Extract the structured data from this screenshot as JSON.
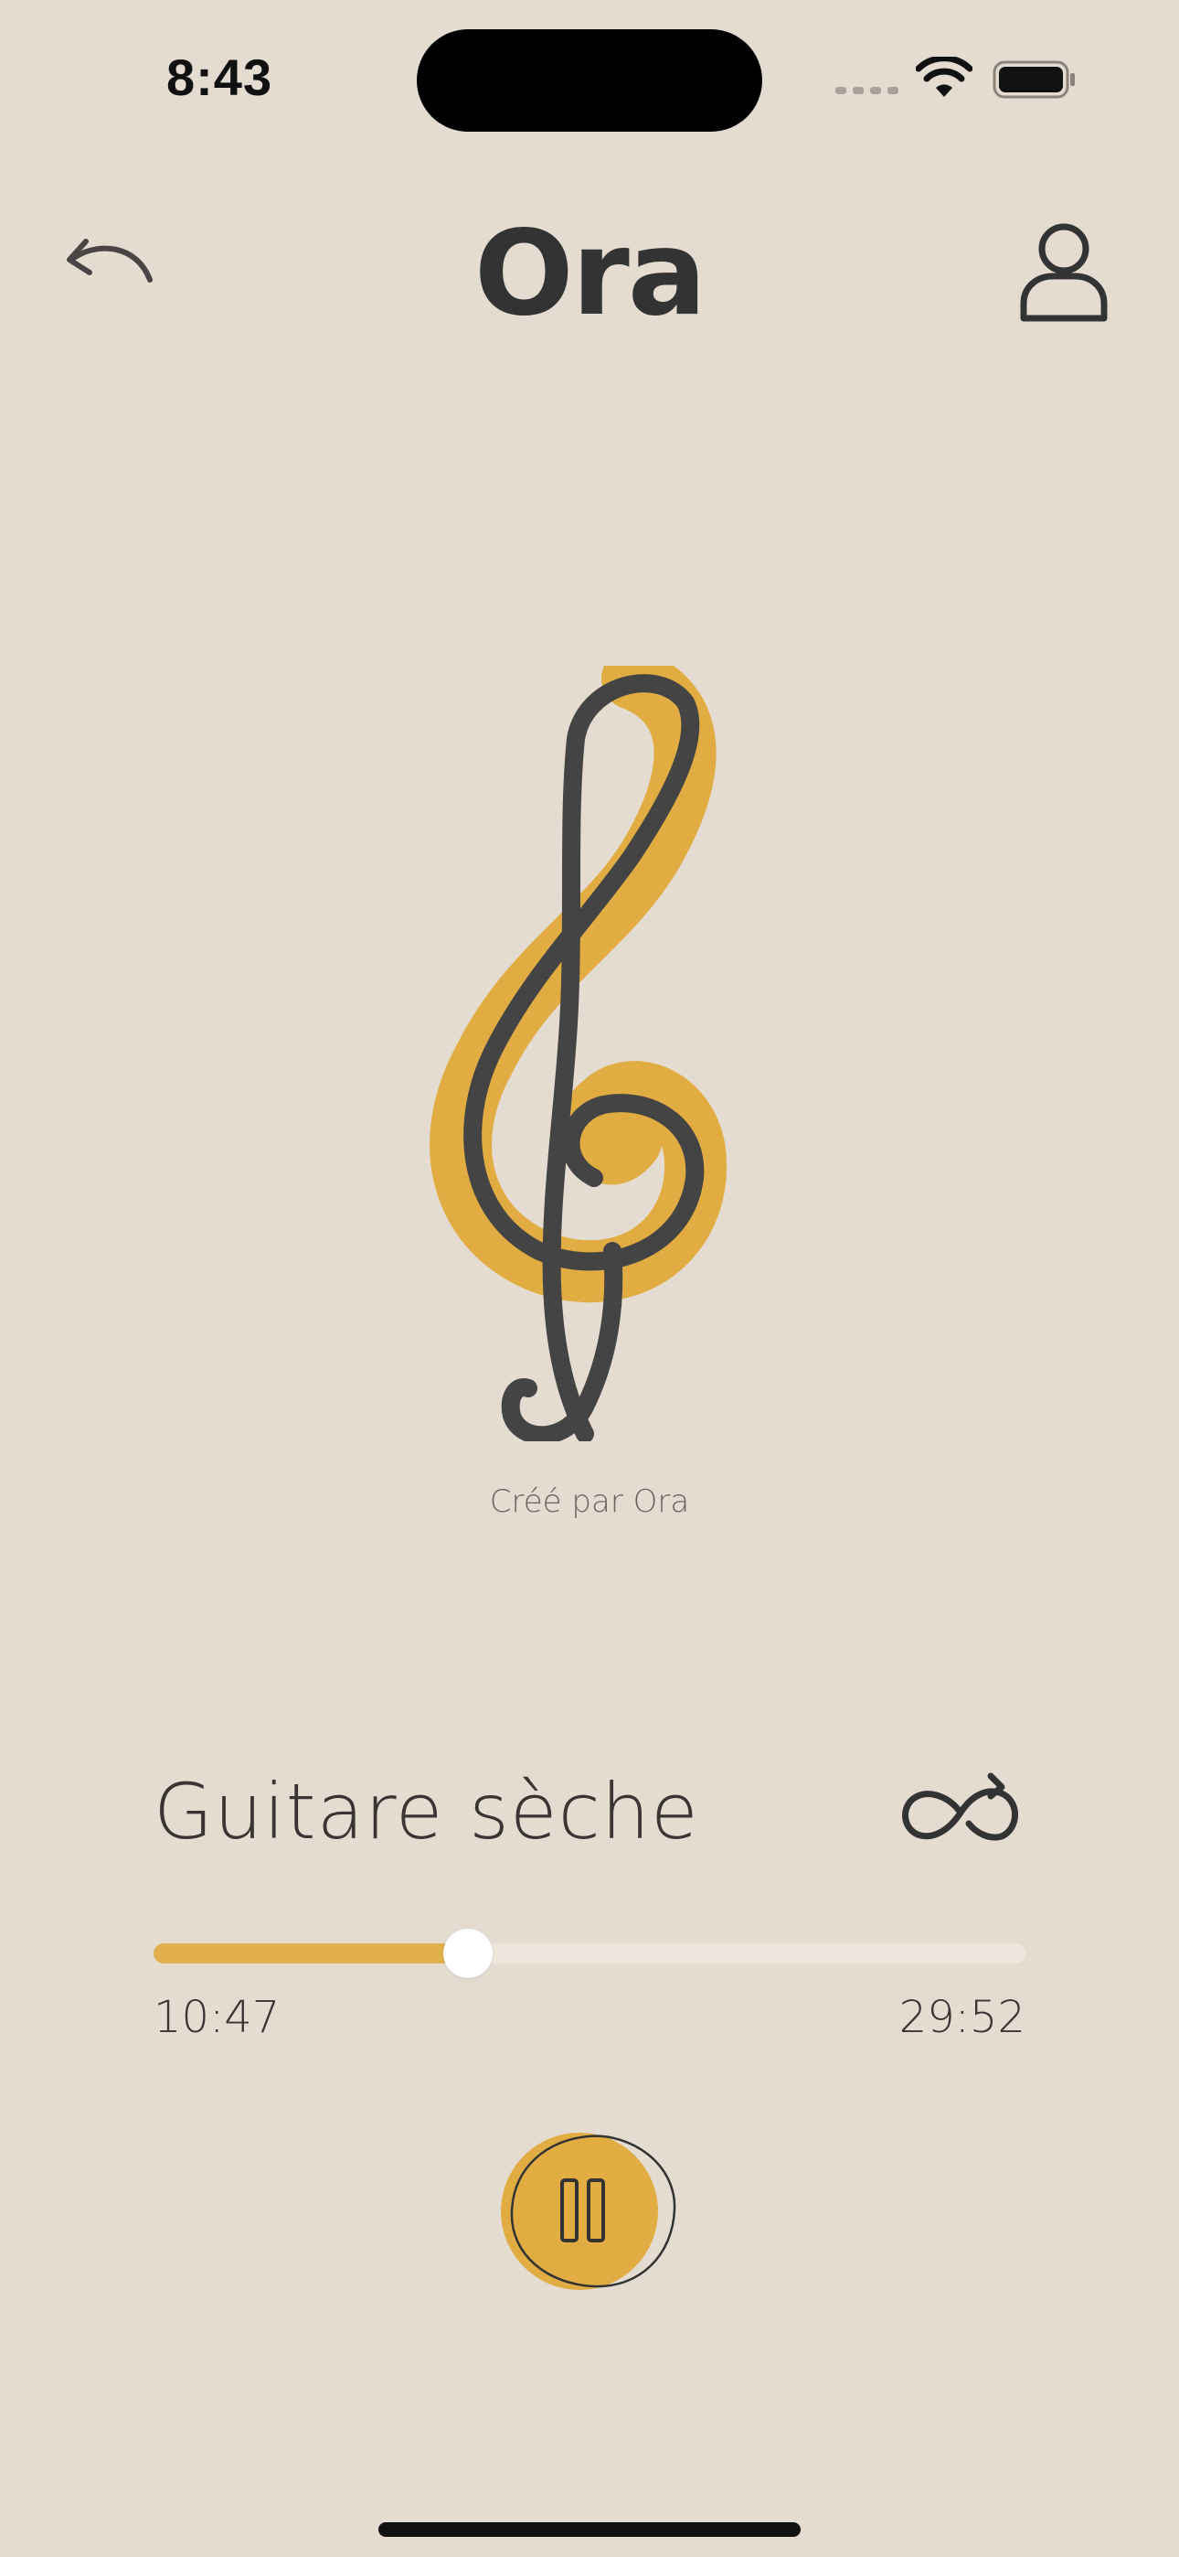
{
  "status_bar": {
    "time": "8:43",
    "icons": [
      "cellular-signal-icon",
      "wifi-icon",
      "battery-icon"
    ]
  },
  "header": {
    "back_icon": "back-arrow-icon",
    "title": "Ora",
    "profile_icon": "user-profile-icon"
  },
  "artwork": {
    "icon": "treble-clef-icon",
    "credit": "Créé par Ora"
  },
  "track": {
    "title": "Guitare sèche",
    "loop_icon": "infinity-loop-icon"
  },
  "playback": {
    "elapsed": "10:47",
    "total": "29:52",
    "progress_fraction": 0.361,
    "state": "playing",
    "control_icon": "pause-icon"
  },
  "colors": {
    "background": "#e4dcd1",
    "accent": "#e1b04d",
    "ink": "#333333",
    "track": "#ede6dd"
  }
}
